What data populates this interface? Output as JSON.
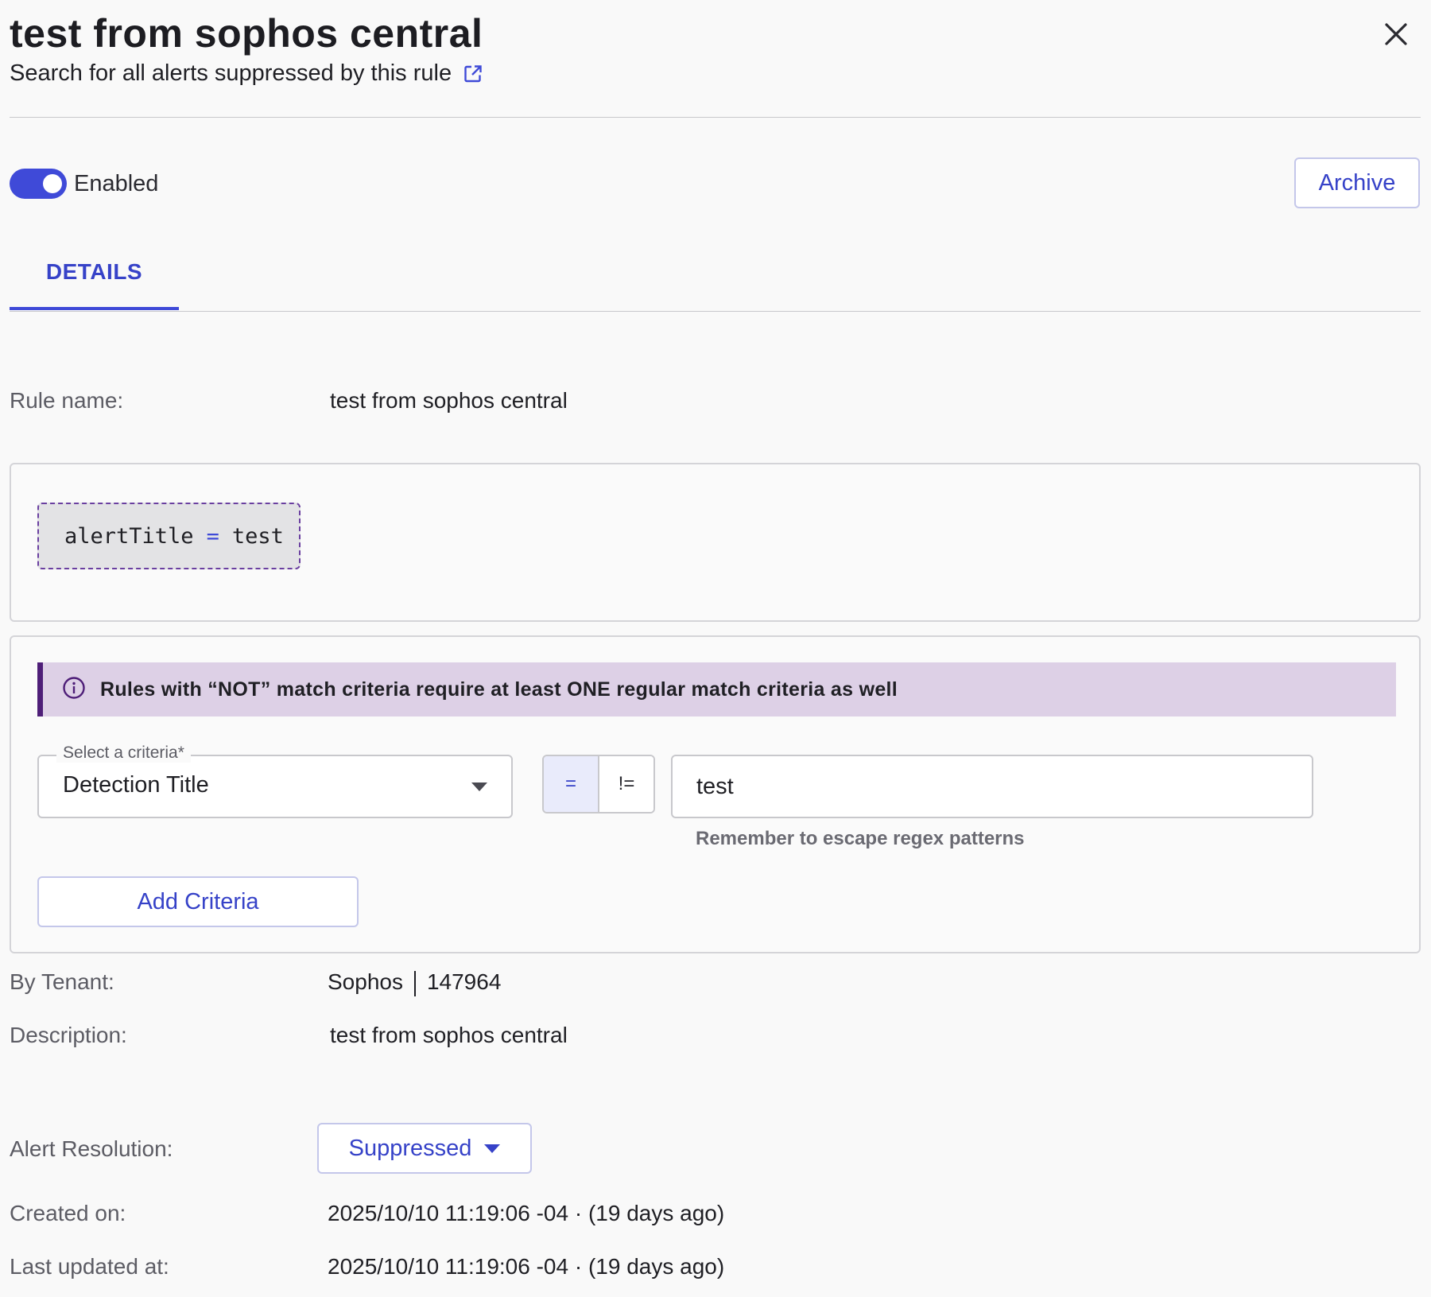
{
  "header": {
    "title": "test from sophos central",
    "search_link": "Search for all alerts suppressed by this rule",
    "external_icon": "external-link-icon",
    "close_icon": "close-icon"
  },
  "toolbar": {
    "enabled_label": "Enabled",
    "enabled": true,
    "archive_label": "Archive"
  },
  "tabs": [
    {
      "label": "DETAILS",
      "active": true
    }
  ],
  "details": {
    "rule_name_label": "Rule name:",
    "rule_name_value": "test from sophos central",
    "query": {
      "field": "alertTitle",
      "operator": "=",
      "value": "test"
    },
    "notice": {
      "icon": "info-icon",
      "text": "Rules with “NOT” match criteria require at least ONE regular match criteria as well"
    },
    "criteria": {
      "select_label": "Select a criteria*",
      "select_value": "Detection Title",
      "op_equal": "=",
      "op_not_equal": "!=",
      "value": "test",
      "hint": "Remember to escape regex patterns",
      "add_label": "Add Criteria"
    },
    "tenant_label": "By Tenant:",
    "tenant_name": "Sophos",
    "tenant_id": "147964",
    "description_label": "Description:",
    "description_value": "test from sophos central",
    "resolution_label": "Alert Resolution:",
    "resolution_value": "Suppressed",
    "created_label": "Created on:",
    "created_value": "2025/10/10 11:19:06 -04 · (19 days ago)",
    "updated_label": "Last updated at:",
    "updated_value": "2025/10/10 11:19:06 -04 · (19 days ago)"
  },
  "colors": {
    "accent": "#3f4ad8",
    "notice_bg": "#ddd0e6",
    "notice_border": "#4e1e78"
  }
}
